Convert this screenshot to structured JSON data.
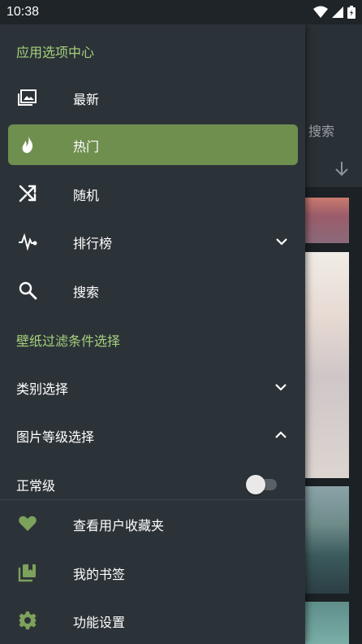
{
  "status_bar": {
    "time": "10:38"
  },
  "background": {
    "search_label": "搜索"
  },
  "drawer": {
    "section_title": "应用选项中心",
    "nav_items": [
      {
        "label": "最新",
        "icon": "image-icon",
        "active": false
      },
      {
        "label": "热门",
        "icon": "flame-icon",
        "active": true
      },
      {
        "label": "随机",
        "icon": "shuffle-icon",
        "active": false
      },
      {
        "label": "排行榜",
        "icon": "activity-icon",
        "active": false,
        "expandable": true
      },
      {
        "label": "搜索",
        "icon": "search-icon",
        "active": false
      }
    ],
    "filter_section_title": "壁纸过滤条件选择",
    "filters": [
      {
        "label": "类别选择",
        "expanded": false
      },
      {
        "label": "图片等级选择",
        "expanded": true
      }
    ],
    "purity": {
      "label": "正常级",
      "enabled": false
    },
    "bottom_items": [
      {
        "label": "查看用户收藏夹",
        "icon": "heart-icon"
      },
      {
        "label": "我的书签",
        "icon": "bookmark-icon"
      },
      {
        "label": "功能设置",
        "icon": "gear-icon"
      }
    ]
  },
  "colors": {
    "accent": "#6f8f4f",
    "section_header": "#a6d17d",
    "drawer_bg": "#2c3338"
  }
}
